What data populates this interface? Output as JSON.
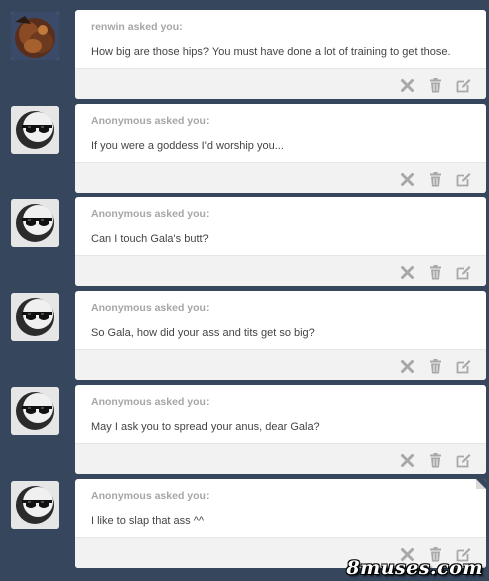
{
  "feed": {
    "posts": [
      {
        "asker": "renwin asked you:",
        "question": "How big are those hips? You must have done a lot of training to get those.",
        "avatar": "character-avatar"
      },
      {
        "asker": "Anonymous asked you:",
        "question": "If you were a goddess I'd worship you...",
        "avatar": "anonymous-sunglasses-avatar"
      },
      {
        "asker": "Anonymous asked you:",
        "question": "Can I touch Gala's butt?",
        "avatar": "anonymous-sunglasses-avatar"
      },
      {
        "asker": "Anonymous asked you:",
        "question": "So Gala, how did your ass and tits get so big?",
        "avatar": "anonymous-sunglasses-avatar"
      },
      {
        "asker": "Anonymous asked you:",
        "question": "May I ask you to spread your anus, dear Gala?",
        "avatar": "anonymous-sunglasses-avatar"
      },
      {
        "asker": "Anonymous asked you:",
        "question": "I like to slap that ass ^^",
        "avatar": "anonymous-sunglasses-avatar"
      }
    ],
    "actions": [
      "close-icon",
      "trash-icon",
      "edit-icon"
    ]
  },
  "watermark": "8muses.com",
  "colors": {
    "background": "#36465d",
    "card": "#ffffff",
    "footer": "#f2f2f2",
    "asker": "#a6a6a6",
    "icon": "#a8a8a8"
  }
}
